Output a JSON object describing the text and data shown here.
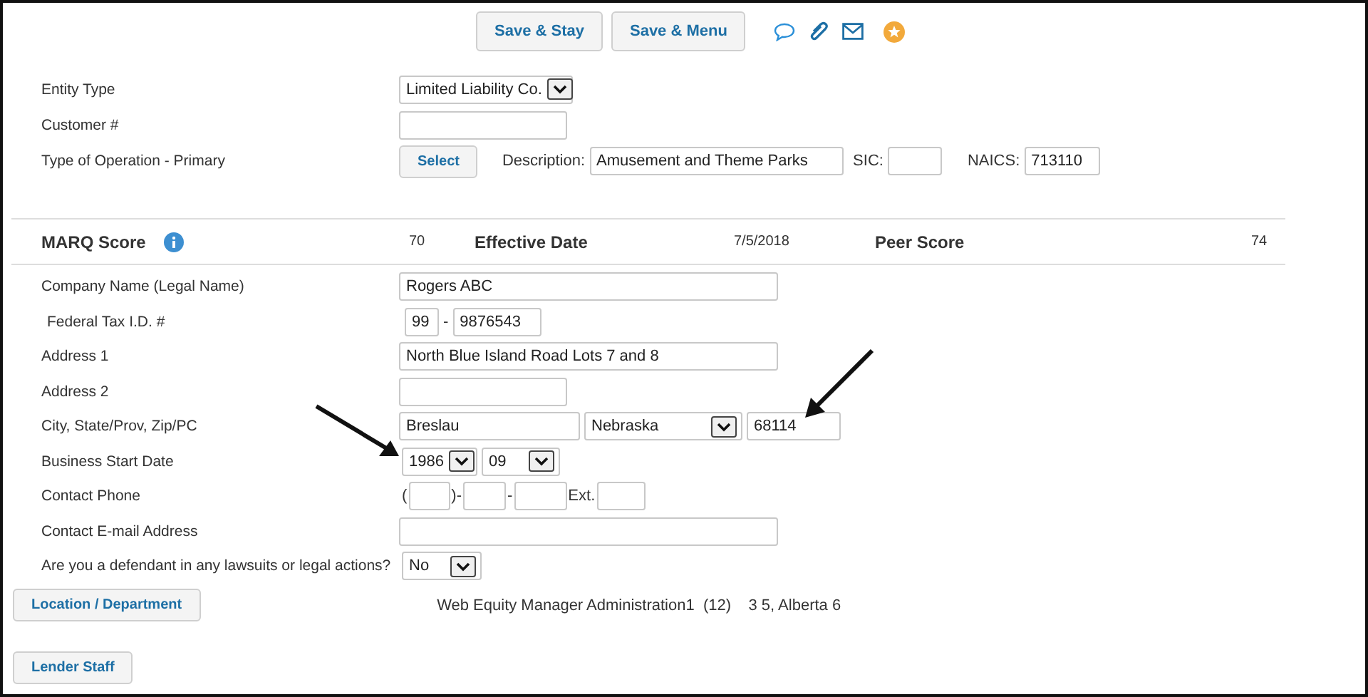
{
  "toolbar": {
    "buttons": [
      "Save & Stay",
      "Save & Menu"
    ]
  },
  "top_rows": [
    {
      "kind": "select",
      "label": "Entity Type",
      "value": "Limited Liability Co."
    },
    {
      "kind": "text",
      "label": "Customer #"
    },
    {
      "kind": "operation",
      "label": "Type of Operation - Primary",
      "button": "Select",
      "description_label": "Description:",
      "description": "Amusement and Theme Parks",
      "sic_label": "SIC:",
      "naics_label": "NAICS:",
      "naics": "713110"
    }
  ],
  "score_bar": {
    "title": "MARQ Score",
    "score": "70",
    "date_label": "Effective Date",
    "date": "7/5/2018",
    "peer_label": "Peer Score",
    "peer": "74"
  },
  "rows": [
    {
      "kind": "text",
      "label": "Company Name (Legal Name)",
      "value": "Rogers ABC"
    },
    {
      "kind": "tax_id",
      "label": "Federal Tax I.D. #",
      "prefix": "99",
      "separator": "-",
      "value": "9876543"
    },
    {
      "kind": "text",
      "label": "Address 1",
      "value": "North Blue Island Road Lots 7 and 8"
    },
    {
      "kind": "text",
      "label": "Address 2"
    },
    {
      "kind": "city",
      "label": "City, State/Prov, Zip/PC",
      "city": "Breslau",
      "state": "Nebraska",
      "zip": "68114"
    },
    {
      "kind": "date",
      "label": "Business Start Date",
      "year": "1986",
      "month": "09"
    },
    {
      "kind": "phone",
      "label": "Contact Phone",
      "open": "(",
      "close": ")-",
      "dash": "-",
      "ext": "Ext."
    },
    {
      "kind": "text",
      "label": "Contact E-mail Address"
    },
    {
      "kind": "yesno",
      "label": "Are you a defendant in any lawsuits or legal actions?",
      "value": "No"
    }
  ],
  "location": {
    "button": "Location / Department",
    "text": "Web Equity Manager Administration1  (12)    3 5, Alberta 6"
  },
  "lender_button": "Lender Staff"
}
